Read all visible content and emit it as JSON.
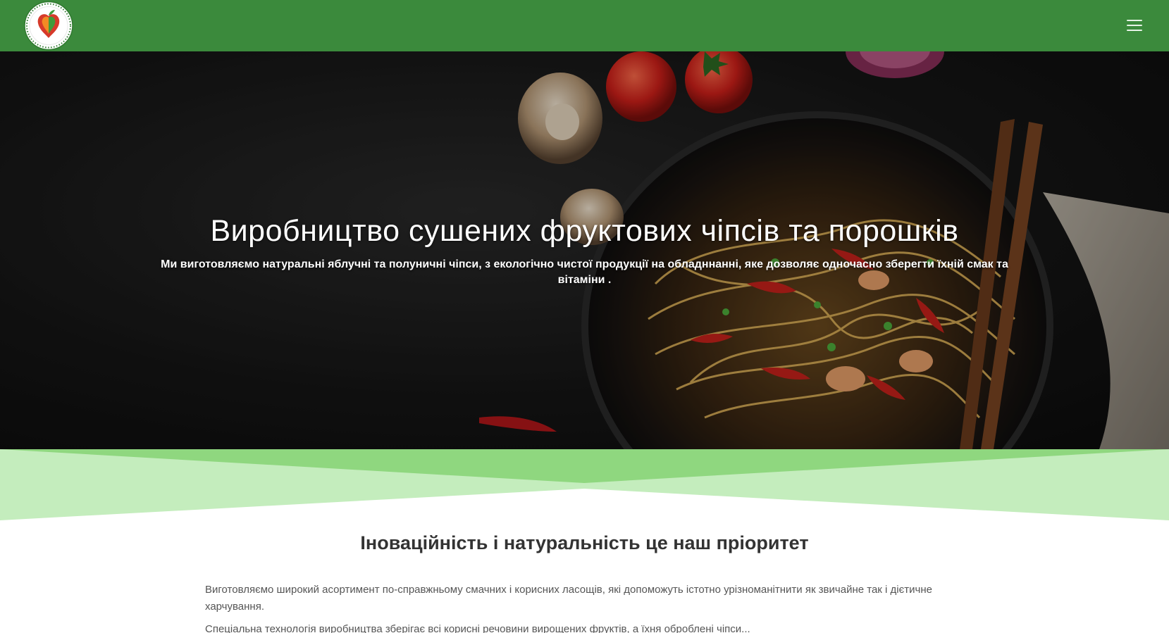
{
  "colors": {
    "navbar": "#3b8a3c",
    "divider_dark": "#8fd77f",
    "divider_light": "#c4edbd",
    "text_dark": "#333333",
    "text_body": "#555555"
  },
  "header": {
    "logo_icon": "apple-heart-logo-icon",
    "menu_icon": "hamburger-menu-icon"
  },
  "hero": {
    "title": "Виробництво сушених фруктових чіпсів та порошків",
    "subtitle": "Ми виготовляємо натуральні яблучні та полуничні чіпси, з екологічно чистої продукції на обладннанні, яке дозволяє одночасно зберегти їхній смак та вітаміни ."
  },
  "about": {
    "title": "Іноваційність і натуральність це наш пріоритет",
    "paragraph_1": "Виготовляємо широкий асортимент по-справжньому смачних і корисних ласощів, які допоможуть істотно урізноманітнити як звичайне так і дієтичне харчування.",
    "paragraph_2": "Спеціальна технологія виробництва зберігає всі корисні речовини вирощених фруктів, а їхня оброблені чіпси..."
  }
}
